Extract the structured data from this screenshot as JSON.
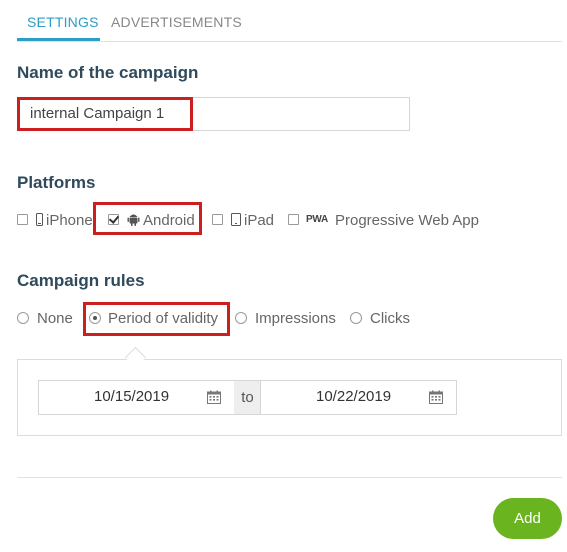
{
  "tabs": [
    {
      "label": "SETTINGS",
      "active": true
    },
    {
      "label": "ADVERTISEMENTS",
      "active": false
    }
  ],
  "name_section": {
    "title": "Name of the campaign",
    "value": "internal Campaign 1"
  },
  "platforms_section": {
    "title": "Platforms",
    "items": [
      {
        "label": "iPhone",
        "icon": "iphone-icon",
        "checked": false
      },
      {
        "label": "Android",
        "icon": "android-icon",
        "checked": true
      },
      {
        "label": "iPad",
        "icon": "ipad-icon",
        "checked": false
      },
      {
        "label": "Progressive Web App",
        "icon": "pwa-icon",
        "icon_text": "PWA",
        "checked": false
      }
    ]
  },
  "rules_section": {
    "title": "Campaign rules",
    "options": [
      {
        "label": "None",
        "selected": false
      },
      {
        "label": "Period of validity",
        "selected": true
      },
      {
        "label": "Impressions",
        "selected": false
      },
      {
        "label": "Clicks",
        "selected": false
      }
    ],
    "date_from": "10/15/2019",
    "date_separator": "to",
    "date_to": "10/22/2019"
  },
  "actions": {
    "add_label": "Add"
  },
  "colors": {
    "accent": "#2a9ec4",
    "title": "#2e4a5c",
    "highlight": "#cc1f1f",
    "add_button": "#6ab41f"
  }
}
